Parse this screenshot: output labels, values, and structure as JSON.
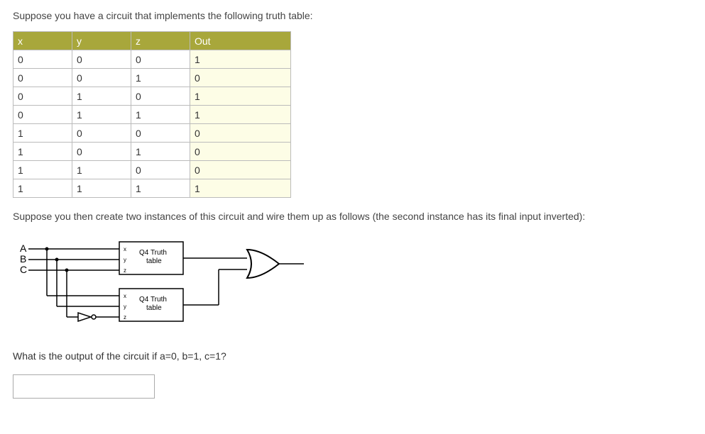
{
  "intro": "Suppose you have a circuit that implements the following truth table:",
  "table": {
    "headers": [
      "x",
      "y",
      "z",
      "Out"
    ],
    "rows": [
      [
        "0",
        "0",
        "0",
        "1"
      ],
      [
        "0",
        "0",
        "1",
        "0"
      ],
      [
        "0",
        "1",
        "0",
        "1"
      ],
      [
        "0",
        "1",
        "1",
        "1"
      ],
      [
        "1",
        "0",
        "0",
        "0"
      ],
      [
        "1",
        "0",
        "1",
        "0"
      ],
      [
        "1",
        "1",
        "0",
        "0"
      ],
      [
        "1",
        "1",
        "1",
        "1"
      ]
    ]
  },
  "mid_text": "Suppose you then create two instances of this circuit and wire them up as follows (the second instance has its final input inverted):",
  "diagram": {
    "inputs": [
      "A",
      "B",
      "C"
    ],
    "block_label_top": "Q4 Truth\ntable",
    "block_label_bot": "Q4 Truth\ntable",
    "port_labels": [
      "x",
      "y",
      "z"
    ]
  },
  "question": "What is the output of the circuit if a=0, b=1, c=1?",
  "answer_value": ""
}
